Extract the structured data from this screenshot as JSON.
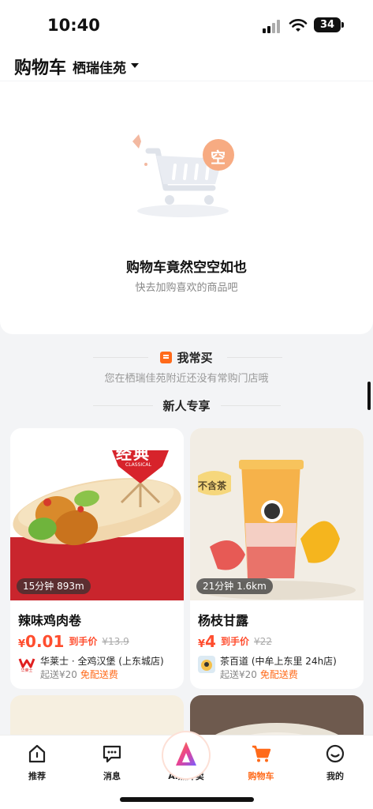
{
  "status_bar": {
    "time": "10:40",
    "battery": "34"
  },
  "header": {
    "title": "购物车",
    "location": "栖瑞佳苑"
  },
  "empty_state": {
    "badge": "空",
    "title": "购物车竟然空空如也",
    "subtitle": "快去加购喜欢的商品吧"
  },
  "frequent": {
    "title": "我常买",
    "subtitle": "您在栖瑞佳苑附近还没有常购门店哦"
  },
  "new_user": {
    "title": "新人专享"
  },
  "products": [
    {
      "badge": "经典",
      "badge_sub": "CLASSICAL",
      "time_distance": "15分钟 893m",
      "name": "辣味鸡肉卷",
      "currency": "¥",
      "price": "0.01",
      "price_label": "到手价",
      "original_price": "¥13.9",
      "shop_logo_text": "华莱士",
      "shop": "华莱士 · 全鸡汉堡 (上东城店)",
      "delivery_min": "起送¥20",
      "delivery_fee": "免配送费"
    },
    {
      "badge": "不含茶",
      "time_distance": "21分钟 1.6km",
      "name": "杨枝甘露",
      "currency": "¥",
      "price": "4",
      "price_label": "到手价",
      "original_price": "¥22",
      "shop": "茶百道 (中牟上东里 24h店)",
      "delivery_min": "起送¥20",
      "delivery_fee": "免配送费"
    }
  ],
  "tabs": [
    {
      "label": "推荐",
      "icon": "home-icon"
    },
    {
      "label": "消息",
      "icon": "message-icon"
    },
    {
      "label": "AI点外卖",
      "icon": "ai-icon"
    },
    {
      "label": "购物车",
      "icon": "cart-icon",
      "active": true
    },
    {
      "label": "我的",
      "icon": "profile-icon"
    }
  ],
  "colors": {
    "accent": "#ff6a1a",
    "price": "#ff4d2e",
    "background": "#f3f4f6"
  }
}
